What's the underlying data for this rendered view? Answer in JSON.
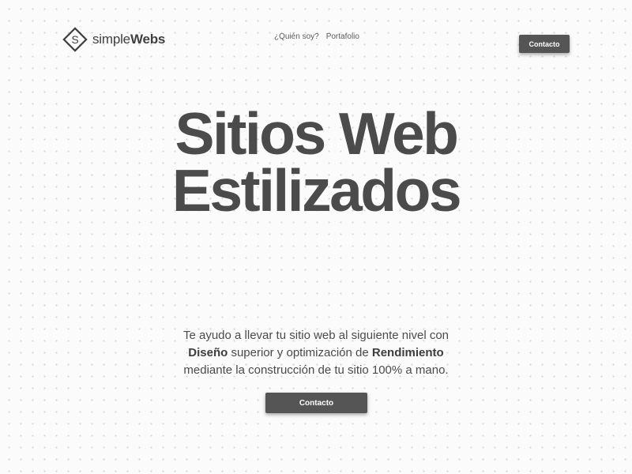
{
  "header": {
    "logo": {
      "icon": "s-diamond-logo-icon",
      "letter": "S",
      "name_light": "simple",
      "name_bold": "Webs"
    },
    "nav": [
      {
        "label": "¿Quién soy?"
      },
      {
        "label": "Portafolio"
      }
    ],
    "cta_label": "Contacto"
  },
  "hero": {
    "title_line1": "Sitios Web",
    "title_line2": "Estilizados",
    "subtitle": {
      "line1": "Te ayudo a llevar tu sitio web al siguiente nivel con",
      "line2_bold1": "Diseño",
      "line2_mid": " superior y optimización de ",
      "line2_bold2": "Rendimiento",
      "line3": "mediante la construcción de tu sitio 100% a mano."
    },
    "cta_label": "Contacto"
  },
  "colors": {
    "background": "#fbfbfb",
    "dots": "#d6d6d6",
    "text": "#4b4b4b",
    "button": "#555555",
    "button_text": "#ffffff"
  }
}
